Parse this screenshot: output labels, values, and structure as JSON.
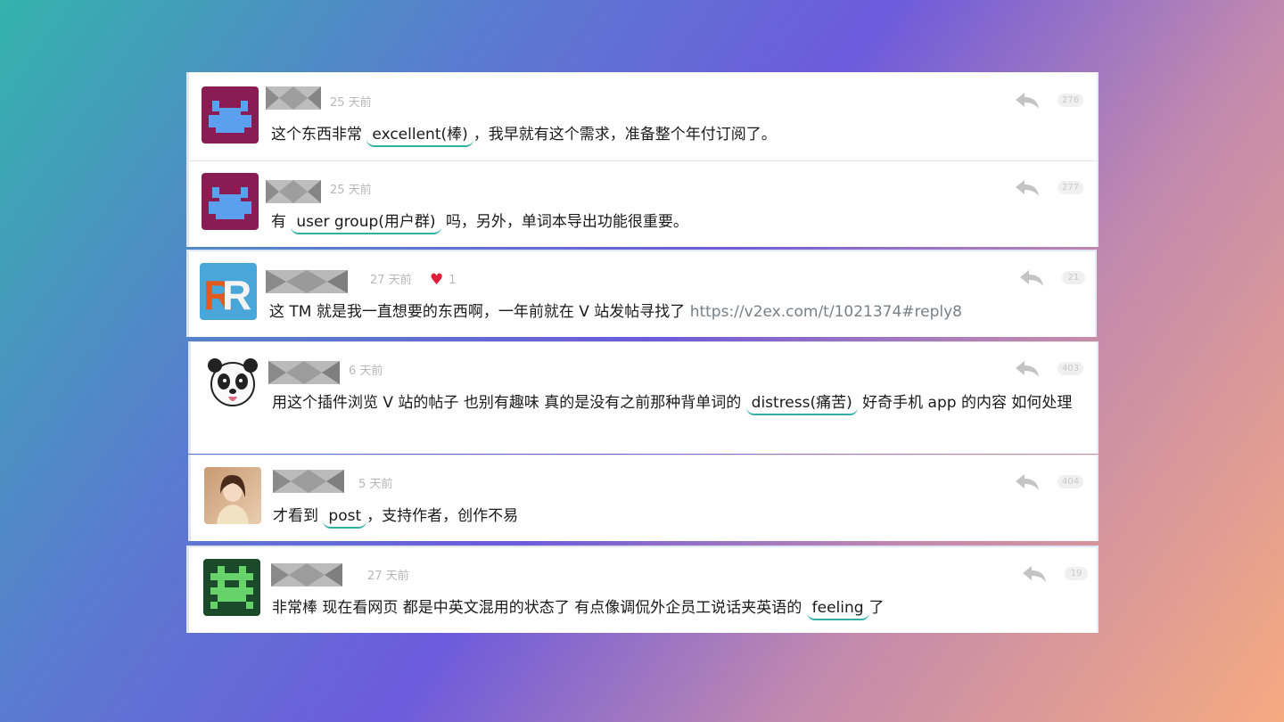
{
  "comments": [
    {
      "time": "25 天前",
      "floor": "276",
      "text_before": "这个东西非常",
      "highlight": "excellent(棒)",
      "text_after": "，我早就有这个需求，准备整个年付订阅了。",
      "avatar": "pixel-avatar-purple"
    },
    {
      "time": "25 天前",
      "floor": "277",
      "text_before": "有",
      "highlight": "user group(用户群)",
      "text_after": "吗，另外，单词本导出功能很重要。",
      "avatar": "pixel-avatar-purple"
    },
    {
      "time": "27 天前",
      "floor": "21",
      "likes": "1",
      "text_before": "这 TM 就是我一直想要的东西啊，一年前就在 V 站发帖寻找了",
      "link": "https://v2ex.com/t/1021374#reply8",
      "avatar": "rr-logo-avatar"
    },
    {
      "time": "6 天前",
      "floor": "403",
      "text_before": "用这个插件浏览 V 站的帖子 也别有趣味 真的是没有之前那种背单词的",
      "highlight": "distress(痛苦)",
      "text_after": "好奇手机 app 的内容 如何处理",
      "avatar": "panda-avatar"
    },
    {
      "time": "5 天前",
      "floor": "404",
      "text_before": "才看到",
      "highlight": "post",
      "text_after": "，支持作者，创作不易",
      "avatar": "photo-avatar"
    },
    {
      "time": "27 天前",
      "floor": "19",
      "text_before": "非常棒 现在看网页 都是中英文混用的状态了 有点像调侃外企员工说话夹英语的",
      "highlight": "feeling",
      "text_after": "了",
      "avatar": "pixel-avatar-green"
    }
  ],
  "colors": {
    "highlight_underline": "#33b0a6",
    "timestamp": "#b7b7b7",
    "link": "#778087",
    "heart": "#e0203a"
  },
  "icons": {
    "reply": "reply-arrow-icon",
    "like": "heart-icon"
  }
}
